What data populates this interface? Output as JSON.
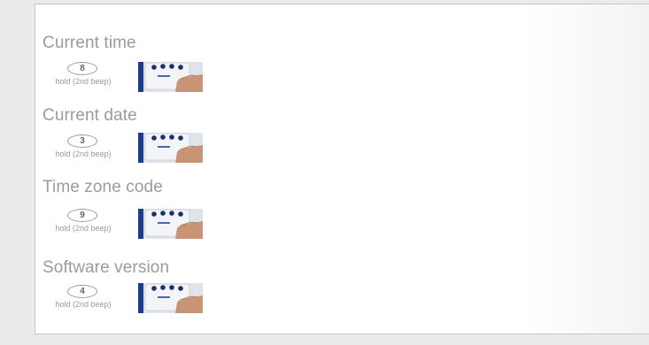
{
  "sections": [
    {
      "title": "Current time",
      "key": "8",
      "hint": "hold (2nd beep)"
    },
    {
      "title": "Current date",
      "key": "3",
      "hint": "hold (2nd beep)"
    },
    {
      "title": "Time zone code",
      "key": "9",
      "hint": "hold (2nd beep)"
    },
    {
      "title": "Software version",
      "key": "4",
      "hint": "hold (2nd beep)"
    }
  ]
}
